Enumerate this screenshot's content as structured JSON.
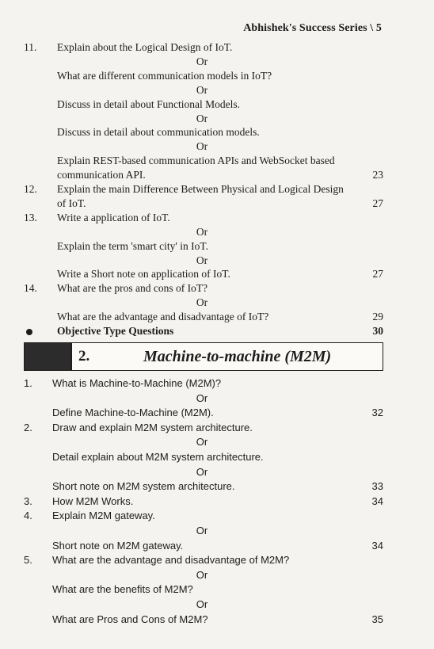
{
  "header": {
    "series": "Abhishek's Success Series \\ 5"
  },
  "section1": [
    {
      "num": "11.",
      "text": "Explain about the Logical Design of IoT.",
      "page": ""
    },
    {
      "or": "Or"
    },
    {
      "text": "What are different communication models in IoT?",
      "page": ""
    },
    {
      "or": "Or"
    },
    {
      "text": "Discuss in detail about Functional Models.",
      "page": ""
    },
    {
      "or": "Or"
    },
    {
      "text": "Discuss in detail about communication models.",
      "page": ""
    },
    {
      "or": "Or"
    },
    {
      "text": "Explain REST-based communication APIs and WebSocket based",
      "page": ""
    },
    {
      "text": "communication API.",
      "page": "23"
    },
    {
      "num": "12.",
      "text": "Explain the main Difference Between Physical and Logical Design",
      "page": ""
    },
    {
      "text": "of IoT.",
      "page": "27"
    },
    {
      "num": "13.",
      "text": "Write a application of IoT.",
      "page": ""
    },
    {
      "or": "Or"
    },
    {
      "text": "Explain the term 'smart city' in IoT.",
      "page": ""
    },
    {
      "or": "Or"
    },
    {
      "text": "Write a Short note on application of IoT.",
      "page": "27"
    },
    {
      "num": "14.",
      "text": "What are the pros and cons of IoT?",
      "page": ""
    },
    {
      "or": "Or"
    },
    {
      "text": "What are the advantage and disadvantage of IoT?",
      "page": "29"
    }
  ],
  "objective": {
    "text": "Objective Type Questions",
    "page": "30"
  },
  "chapter": {
    "number": "2.",
    "title": "Machine-to-machine (M2M)"
  },
  "section2": [
    {
      "num": "1.",
      "text": "What is Machine-to-Machine (M2M)?",
      "page": ""
    },
    {
      "or": "Or"
    },
    {
      "text": "Define Machine-to-Machine (M2M).",
      "page": "32"
    },
    {
      "num": "2.",
      "text": "Draw and explain M2M system architecture.",
      "page": ""
    },
    {
      "or": "Or"
    },
    {
      "text": "Detail explain about M2M system architecture.",
      "page": ""
    },
    {
      "or": "Or"
    },
    {
      "text": "Short note on M2M system architecture.",
      "page": "33"
    },
    {
      "num": "3.",
      "text": "How M2M Works.",
      "page": "34"
    },
    {
      "num": "4.",
      "text": "Explain M2M gateway.",
      "page": ""
    },
    {
      "or": "Or"
    },
    {
      "text": "Short note on M2M gateway.",
      "page": "34"
    },
    {
      "num": "5.",
      "text": "What are the advantage and disadvantage of M2M?",
      "page": ""
    },
    {
      "or": "Or"
    },
    {
      "text": "What are the benefits of M2M?",
      "page": ""
    },
    {
      "or": "Or"
    },
    {
      "text": "What are Pros and Cons of M2M?",
      "page": "35"
    }
  ]
}
